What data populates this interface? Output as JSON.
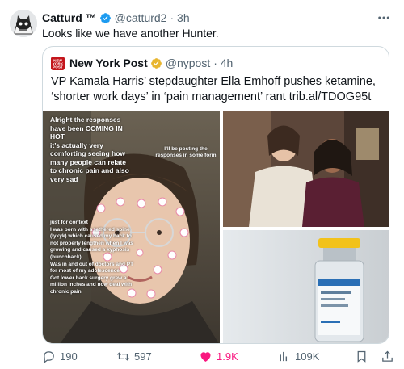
{
  "author": {
    "display_name": "Catturd ™",
    "handle": "@catturd2",
    "time": "· 3h"
  },
  "tweet_text": "Looks like we have another Hunter.",
  "quote": {
    "logo_text": "NEW YORK POST",
    "display_name": "New York Post",
    "handle": "@nypost",
    "time": "· 4h",
    "text": "VP Kamala Harris’ stepdaughter Ella Emhoff pushes ketamine, ‘shorter work days’ in ‘pain management’ rant trib.al/TDOG95t",
    "media": {
      "overlay_main": "Alright the responses have been COMING IN HOT\nit’s actually very comforting seeing how many people can relate to chronic pain and also very sad",
      "overlay_side": "I’ll be posting the responses in some form",
      "overlay_context": "just for context\nI was born with a tethered spine (lykyk) which caused my back to not properly lengthen when I was growing and caused a kyphosis (hunchback)\nWas in and out of doctors and PT for most of my adolescence\nGot lower back surgery grew a million inches and now deal with chronic pain"
    }
  },
  "actions": {
    "replies": "190",
    "reposts": "597",
    "likes": "1.9K",
    "views": "109K"
  },
  "colors": {
    "verified_blue": "#1d9bf0",
    "gold_badge": "#e8b630",
    "like_pink": "#f91880",
    "nypost_red": "#c4161c",
    "muted": "#536471"
  }
}
